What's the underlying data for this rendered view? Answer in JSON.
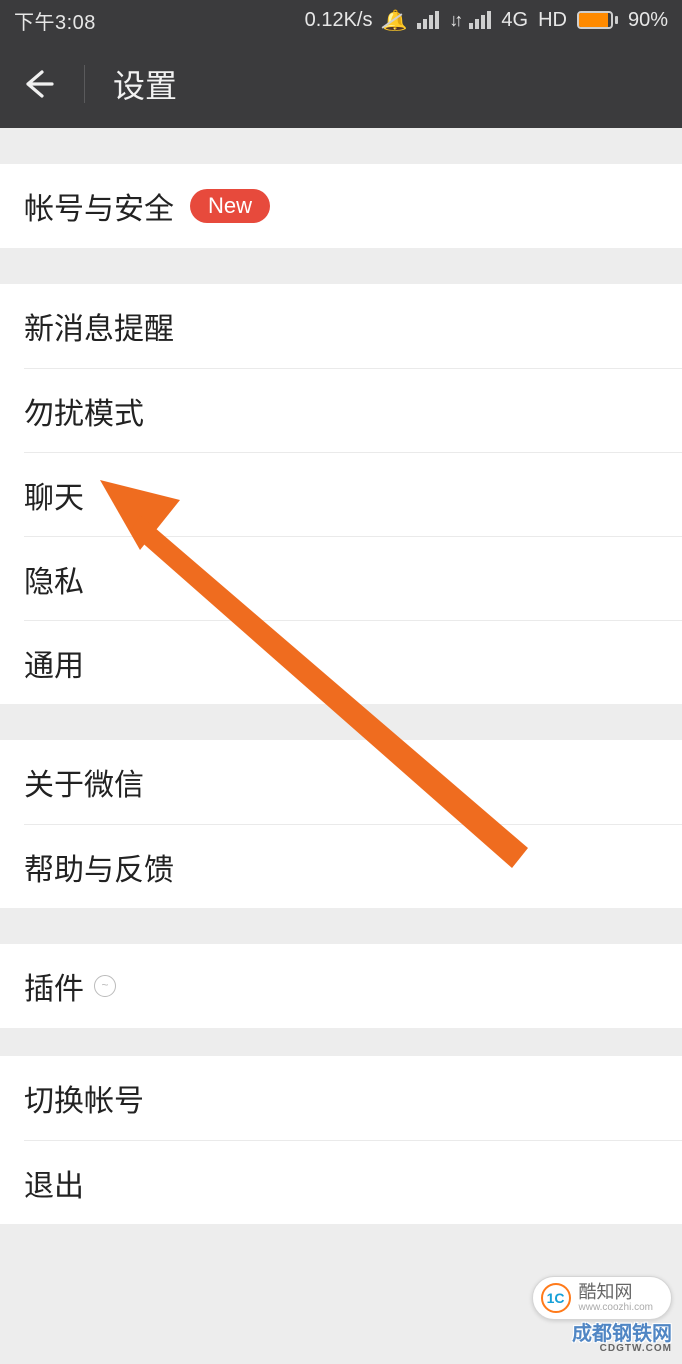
{
  "status": {
    "time": "下午3:08",
    "speed": "0.12K/s",
    "network": "4G",
    "hd": "HD",
    "battery_pct": "90%"
  },
  "header": {
    "title": "设置"
  },
  "groups": {
    "account": {
      "label": "帐号与安全",
      "badge": "New"
    },
    "g1": {
      "notify": "新消息提醒",
      "dnd": "勿扰模式",
      "chat": "聊天",
      "privacy": "隐私",
      "general": "通用"
    },
    "g2": {
      "about": "关于微信",
      "help": "帮助与反馈"
    },
    "g3": {
      "plugin": "插件"
    },
    "g4": {
      "switch": "切换帐号",
      "logout": "退出"
    }
  },
  "watermark": {
    "brand_cn": "酷知网",
    "brand_en": "www.coozhi.com",
    "second": "成都钢铁网",
    "second_sub": "CDGTW.COM"
  },
  "annotation": {
    "arrow_target": "chat"
  }
}
